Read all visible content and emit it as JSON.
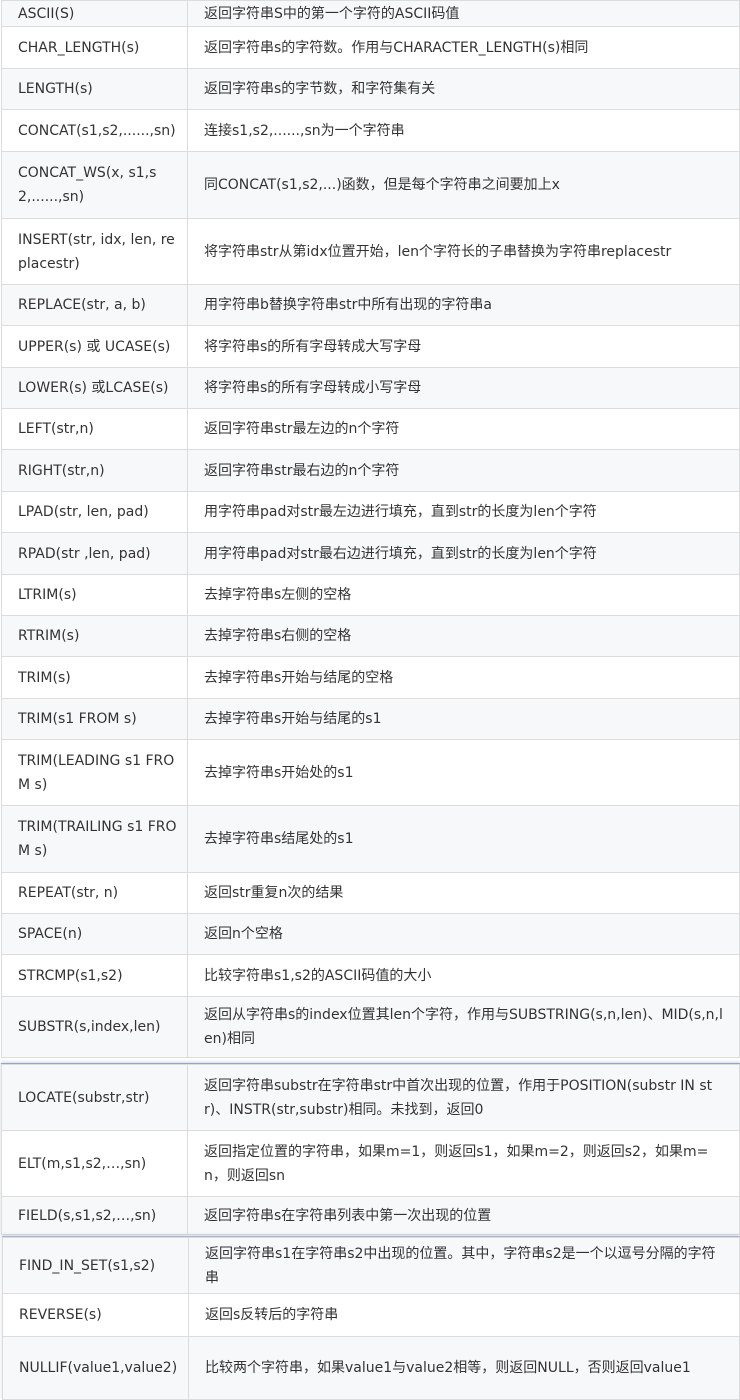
{
  "block1": [
    {
      "func": "ASCII(S)",
      "desc": "返回字符串S中的第一个字符的ASCII码值",
      "h": 26
    },
    {
      "func": "CHAR_LENGTH(s)",
      "desc": "返回字符串s的字符数。作用与CHARACTER_LENGTH(s)相同",
      "h": 42
    },
    {
      "func": "LENGTH(s)",
      "desc": "返回字符串s的字节数，和字符集有关",
      "h": 41
    },
    {
      "func": "CONCAT(s1,s2,......,sn)",
      "desc": "连接s1,s2,......,sn为一个字符串",
      "h": 42
    },
    {
      "func": "CONCAT_WS(x, s1,s2,......,sn)",
      "desc": "同CONCAT(s1,s2,...)函数，但是每个字符串之间要加上x",
      "h": 67
    },
    {
      "func": "INSERT(str, idx, len, replacestr)",
      "desc": "将字符串str从第idx位置开始，len个字符长的子串替换为字符串replacestr",
      "h": 66
    },
    {
      "func": "REPLACE(str, a, b)",
      "desc": "用字符串b替换字符串str中所有出现的字符串a",
      "h": 41
    },
    {
      "func": "UPPER(s) 或 UCASE(s)",
      "desc": "将字符串s的所有字母转成大写字母",
      "h": 42
    },
    {
      "func": "LOWER(s) 或LCASE(s)",
      "desc": "将字符串s的所有字母转成小写字母",
      "h": 41
    },
    {
      "func": "LEFT(str,n)",
      "desc": "返回字符串str最左边的n个字符",
      "h": 41
    },
    {
      "func": "RIGHT(str,n)",
      "desc": "返回字符串str最右边的n个字符",
      "h": 42
    },
    {
      "func": "LPAD(str, len, pad)",
      "desc": "用字符串pad对str最左边进行填充，直到str的长度为len个字符",
      "h": 41
    },
    {
      "func": "RPAD(str ,len, pad)",
      "desc": "用字符串pad对str最右边进行填充，直到str的长度为len个字符",
      "h": 42
    },
    {
      "func": "LTRIM(s)",
      "desc": "去掉字符串s左侧的空格",
      "h": 41
    },
    {
      "func": "RTRIM(s)",
      "desc": "去掉字符串s右侧的空格",
      "h": 41
    },
    {
      "func": "TRIM(s)",
      "desc": "去掉字符串s开始与结尾的空格",
      "h": 42
    },
    {
      "func": "TRIM(s1 FROM s)",
      "desc": "去掉字符串s开始与结尾的s1",
      "h": 41
    },
    {
      "func": "TRIM(LEADING s1 FROM s)",
      "desc": "去掉字符串s开始处的s1",
      "h": 66
    },
    {
      "func": "TRIM(TRAILING s1 FROM s)",
      "desc": "去掉字符串s结尾处的s1",
      "h": 67
    },
    {
      "func": "REPEAT(str, n)",
      "desc": "返回str重复n次的结果",
      "h": 41
    },
    {
      "func": "SPACE(n)",
      "desc": "返回n个空格",
      "h": 41
    },
    {
      "func": "STRCMP(s1,s2)",
      "desc": "比较字符串s1,s2的ASCII码值的大小",
      "h": 42
    },
    {
      "func": "SUBSTR(s,index,len)",
      "desc": "返回从字符串s的index位置其len个字符，作用与SUBSTRING(s,n,len)、MID(s,n,len)相同",
      "h": 61
    }
  ],
  "block2": [
    {
      "func": "LOCATE(substr,str)",
      "desc": "返回字符串substr在字符串str中首次出现的位置，作用于POSITION(substr IN str)、INSTR(str,substr)相同。未找到，返回0",
      "h": 66
    },
    {
      "func": "ELT(m,s1,s2,…,sn)",
      "desc": "返回指定位置的字符串，如果m=1，则返回s1，如果m=2，则返回s2，如果m=n，则返回sn",
      "h": 66
    },
    {
      "func": "FIELD(s,s1,s2,…,sn)",
      "desc": "返回字符串s在字符串列表中第一次出现的位置",
      "h": 38
    }
  ],
  "block3": [
    {
      "func": "FIND_IN_SET(s1,s2)",
      "desc": "返回字符串s1在字符串s2中出现的位置。其中，字符串s2是一个以逗号分隔的字符串",
      "h": 56
    },
    {
      "func": "REVERSE(s)",
      "desc": "返回s反转后的字符串",
      "h": 43
    },
    {
      "func": "NULLIF(value1,value2)",
      "desc": "比较两个字符串，如果value1与value2相等，则返回NULL，否则返回value1",
      "h": 63
    }
  ]
}
